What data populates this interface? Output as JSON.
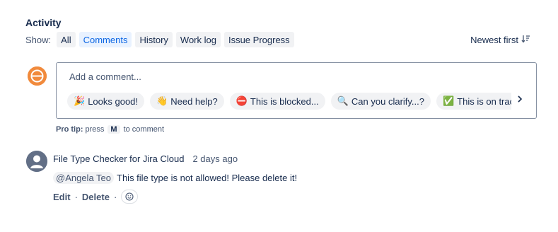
{
  "activity": {
    "heading": "Activity",
    "show_label": "Show:",
    "filters": [
      {
        "label": "All",
        "active": false
      },
      {
        "label": "Comments",
        "active": true
      },
      {
        "label": "History",
        "active": false
      },
      {
        "label": "Work log",
        "active": false
      },
      {
        "label": "Issue Progress",
        "active": false
      }
    ],
    "sort_label": "Newest first",
    "sort_icon": "sort-descending-icon"
  },
  "composer": {
    "placeholder": "Add a comment...",
    "chips": [
      {
        "emoji": "🎉",
        "label": "Looks good!"
      },
      {
        "emoji": "👋",
        "label": "Need help?"
      },
      {
        "emoji": "⛔",
        "label": "This is blocked..."
      },
      {
        "emoji": "🔍",
        "label": "Can you clarify...?"
      },
      {
        "emoji": "✅",
        "label": "This is on track"
      }
    ],
    "next_icon": "chevron-right-icon"
  },
  "pro_tip": {
    "label": "Pro tip:",
    "pre": "press",
    "key": "M",
    "post": "to comment"
  },
  "comment": {
    "author": "File Type Checker for Jira Cloud",
    "time": "2 days ago",
    "mention": "@Angela Teo",
    "text": "This file type is not allowed! Please delete it!",
    "edit_label": "Edit",
    "delete_label": "Delete",
    "separator": "·"
  },
  "colors": {
    "accent": "#0c66e4",
    "avatar_me": "#f18a3c",
    "avatar_user": "#626f86"
  }
}
